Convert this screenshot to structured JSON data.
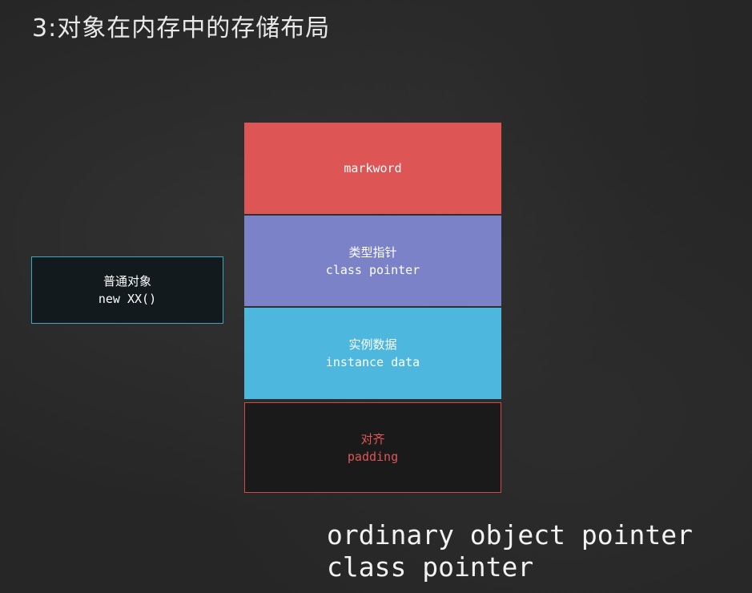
{
  "title": "3:对象在内存中的存储布局",
  "object_box": {
    "label_zh": "普通对象",
    "label_code": "new XX()"
  },
  "layout_blocks": {
    "markword": {
      "label": "markword",
      "color": "#dd5555"
    },
    "class_pointer": {
      "label_zh": "类型指针",
      "label_en": "class pointer",
      "color": "#7b82c7"
    },
    "instance_data": {
      "label_zh": "实例数据",
      "label_en": "instance data",
      "color": "#4db7dd"
    },
    "padding": {
      "label_zh": "对齐",
      "label_en": "padding",
      "color": "#d04a4a"
    }
  },
  "notes": {
    "line1": "ordinary object pointer",
    "line2": "class pointer"
  }
}
